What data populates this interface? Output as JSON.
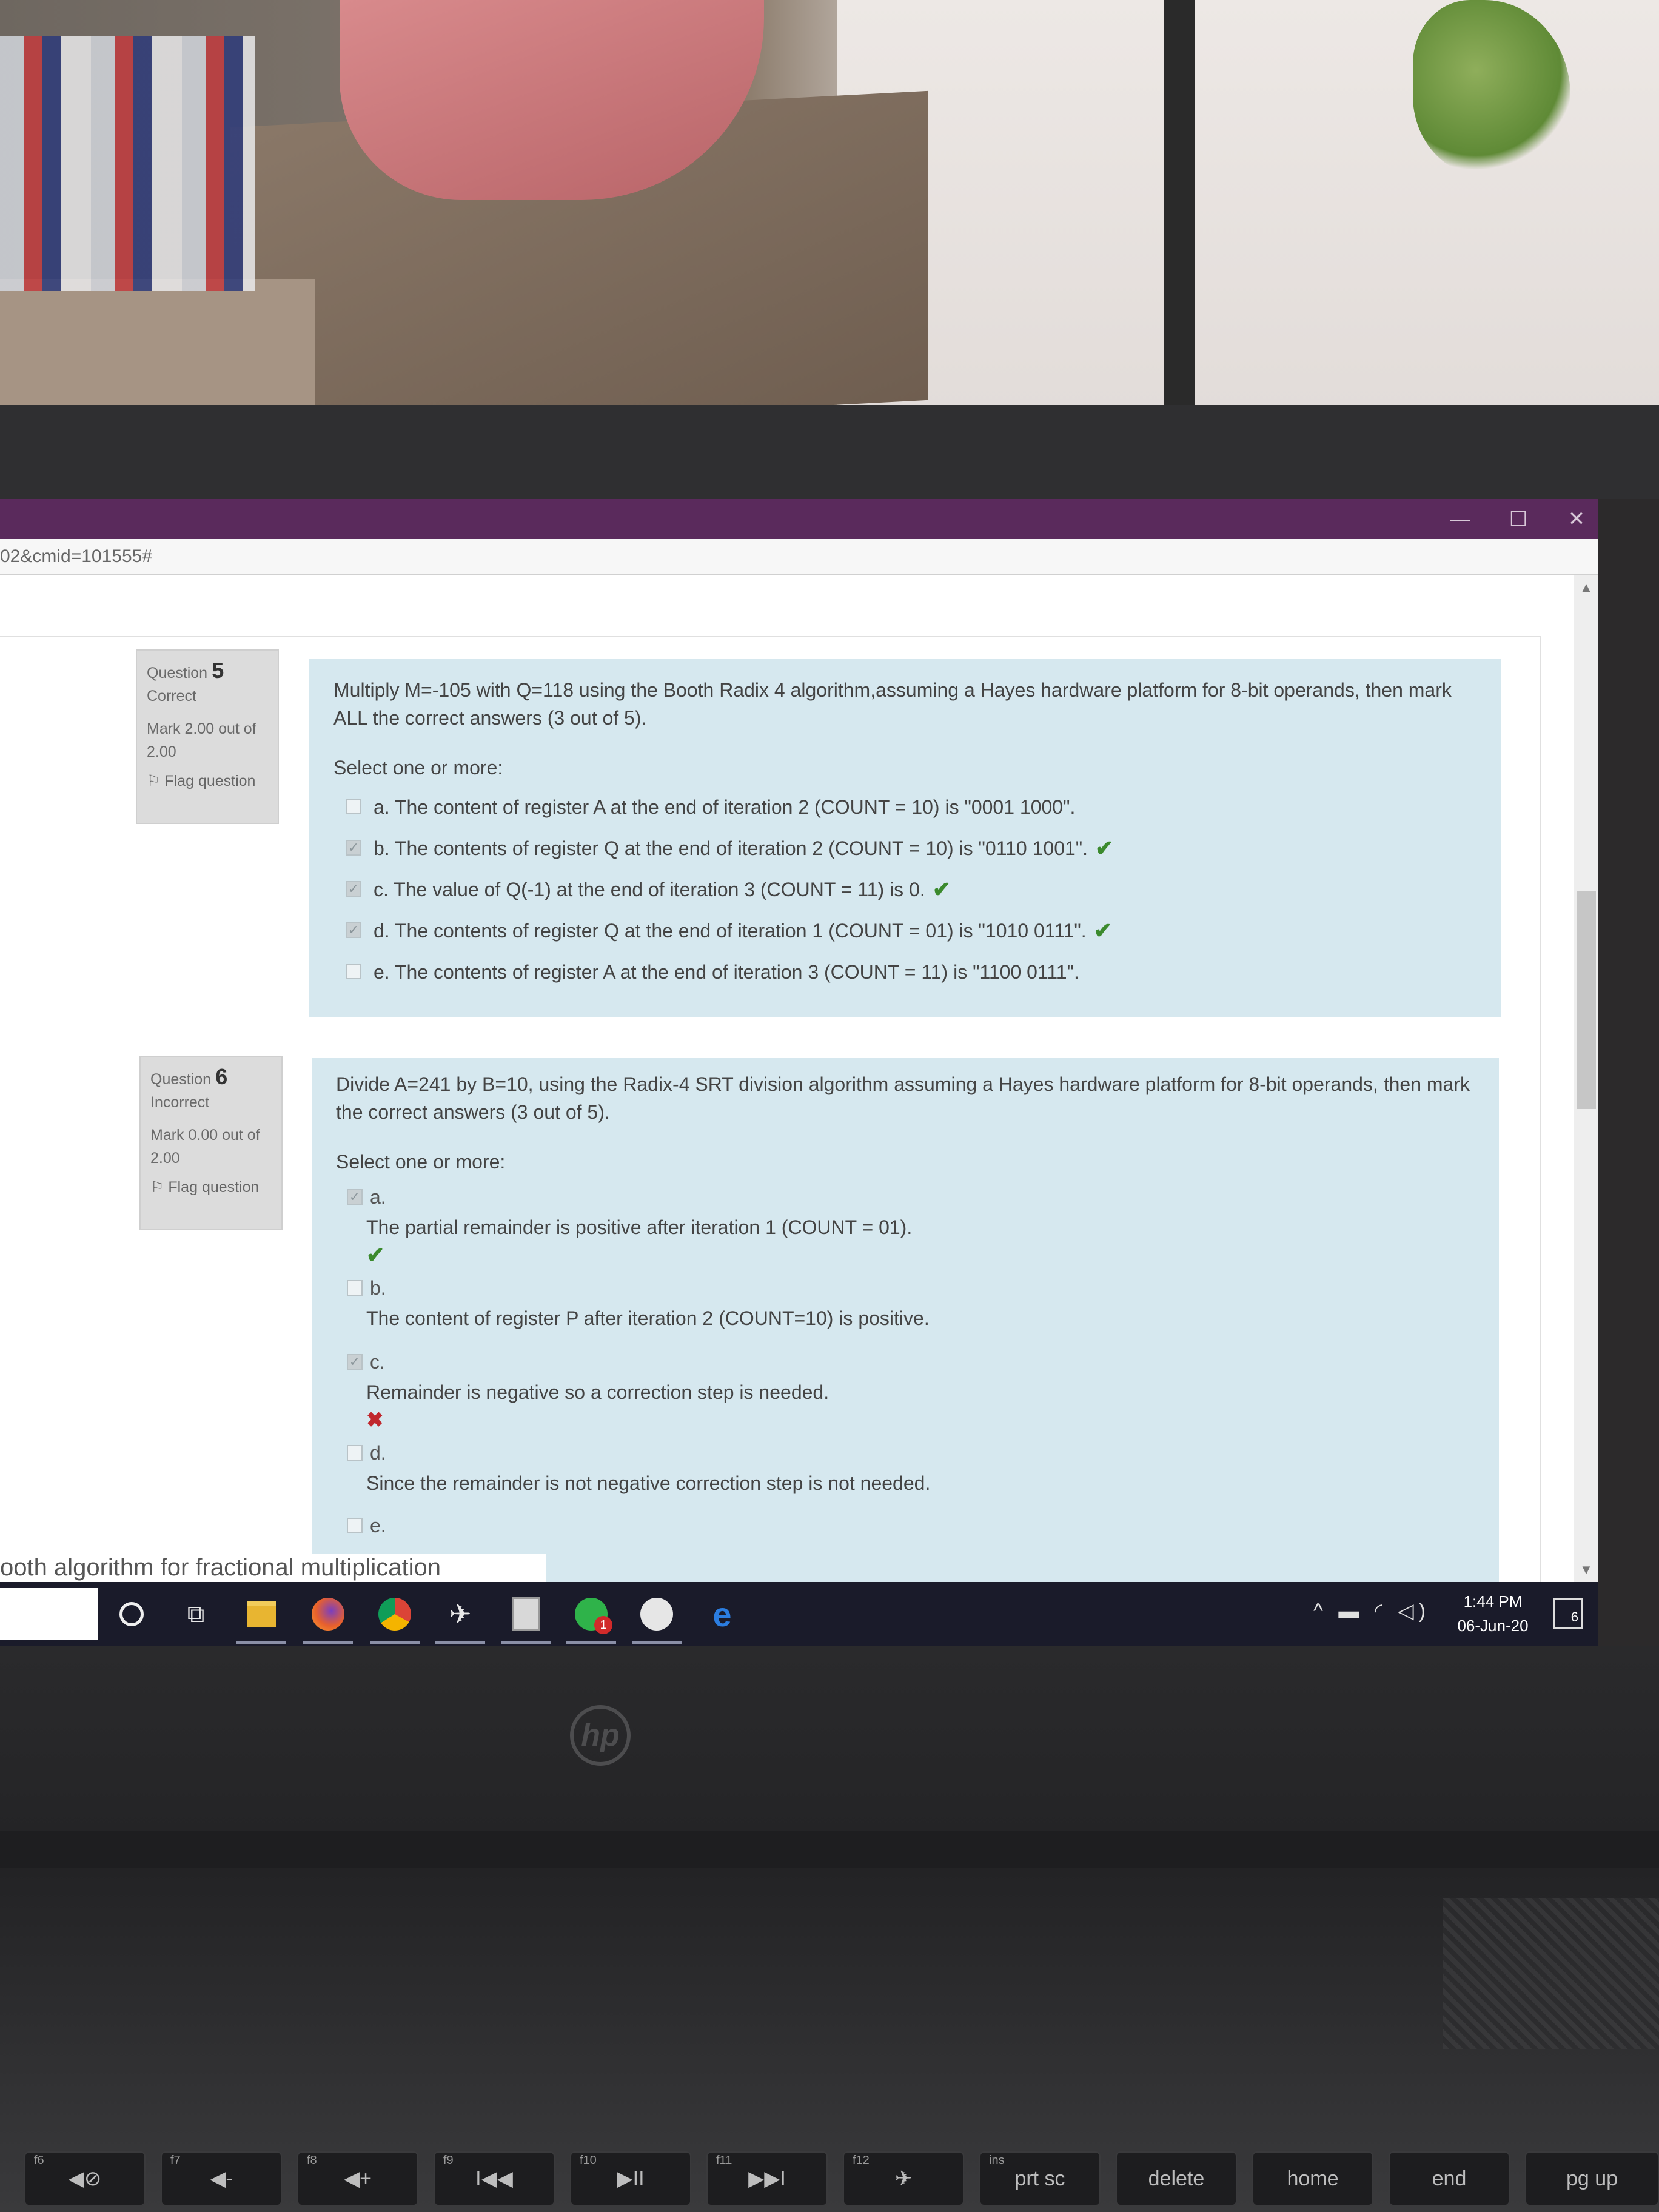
{
  "browser": {
    "url_fragment": "02&cmid=101555#"
  },
  "questions": [
    {
      "label": "Question",
      "number": "5",
      "state": "Correct",
      "mark": "Mark 2.00 out of 2.00",
      "flag": "Flag question",
      "text": "Multiply M=-105 with Q=118 using the Booth Radix 4 algorithm,assuming a Hayes hardware platform for 8-bit operands, then mark ALL the correct answers (3 out of 5).",
      "prompt": "Select one or more:",
      "options": [
        {
          "text": "a. The content of register A at the end of iteration 2 (COUNT = 10) is \"0001 1000\".",
          "checked": false,
          "feedback": ""
        },
        {
          "text": "b. The contents of register Q at the end of iteration 2 (COUNT  = 10) is \"0110 1001\".",
          "checked": true,
          "feedback": "correct"
        },
        {
          "text": "c. The value of Q(-1) at the end of iteration 3 (COUNT = 11) is 0.",
          "checked": true,
          "feedback": "correct"
        },
        {
          "text": "d. The contents of register Q at the end of iteration 1 (COUNT  = 01) is \"1010 0111\".",
          "checked": true,
          "feedback": "correct"
        },
        {
          "text": "e. The contents of register A at the end of iteration 3 (COUNT  = 11) is \"1100 0111\".",
          "checked": false,
          "feedback": ""
        }
      ]
    },
    {
      "label": "Question",
      "number": "6",
      "state": "Incorrect",
      "mark": "Mark 0.00 out of 2.00",
      "flag": "Flag question",
      "text": "Divide A=241 by B=10, using the Radix-4 SRT division algorithm assuming a Hayes hardware platform for 8-bit operands, then mark the correct answers (3 out of 5).",
      "prompt": "Select one or more:",
      "options": [
        {
          "letter": "a.",
          "text": "The partial remainder is positive after iteration 1 (COUNT = 01).",
          "checked": true,
          "feedback": "correct"
        },
        {
          "letter": "b.",
          "text": "The content of register P after iteration 2 (COUNT=10) is positive.",
          "checked": false,
          "feedback": ""
        },
        {
          "letter": "c.",
          "text": "Remainder is negative so a correction step is needed.",
          "checked": true,
          "feedback": "incorrect"
        },
        {
          "letter": "d.",
          "text": "Since the remainder is not negative correction step is not needed.",
          "checked": false,
          "feedback": ""
        },
        {
          "letter": "e.",
          "text": "",
          "checked": false,
          "feedback": ""
        }
      ]
    }
  ],
  "bottom_link_fragment": "ooth algorithm for fractional multiplication",
  "taskbar": {
    "icons": [
      "cortana-icon",
      "task-view-icon",
      "file-explorer-icon",
      "firefox-icon",
      "chrome-icon",
      "steam-icon",
      "calculator-icon",
      "whatsapp-icon",
      "app-icon",
      "edge-icon"
    ],
    "whatsapp_badge": "1",
    "time": "1:44 PM",
    "date": "06-Jun-20",
    "notification_count": "6"
  },
  "keyboard": {
    "keys": [
      {
        "fn": "f6",
        "label": "◀⊘"
      },
      {
        "fn": "f7",
        "label": "◀-"
      },
      {
        "fn": "f8",
        "label": "◀+"
      },
      {
        "fn": "f9",
        "label": "I◀◀"
      },
      {
        "fn": "f10",
        "label": "▶II"
      },
      {
        "fn": "f11",
        "label": "▶▶I"
      },
      {
        "fn": "f12",
        "label": "✈"
      },
      {
        "fn": "ins",
        "label": "prt sc"
      },
      {
        "fn": "",
        "label": "delete"
      },
      {
        "fn": "",
        "label": "home"
      },
      {
        "fn": "",
        "label": "end"
      },
      {
        "fn": "",
        "label": "pg up"
      }
    ]
  },
  "brand": "hp",
  "colors": {
    "titlebar": "#5a2a5c",
    "formulation_bg": "#d6e8ef",
    "info_bg": "#dcdcdc",
    "correct": "#3b8a2d",
    "incorrect": "#c0272d",
    "taskbar": "#1a1b2a"
  }
}
